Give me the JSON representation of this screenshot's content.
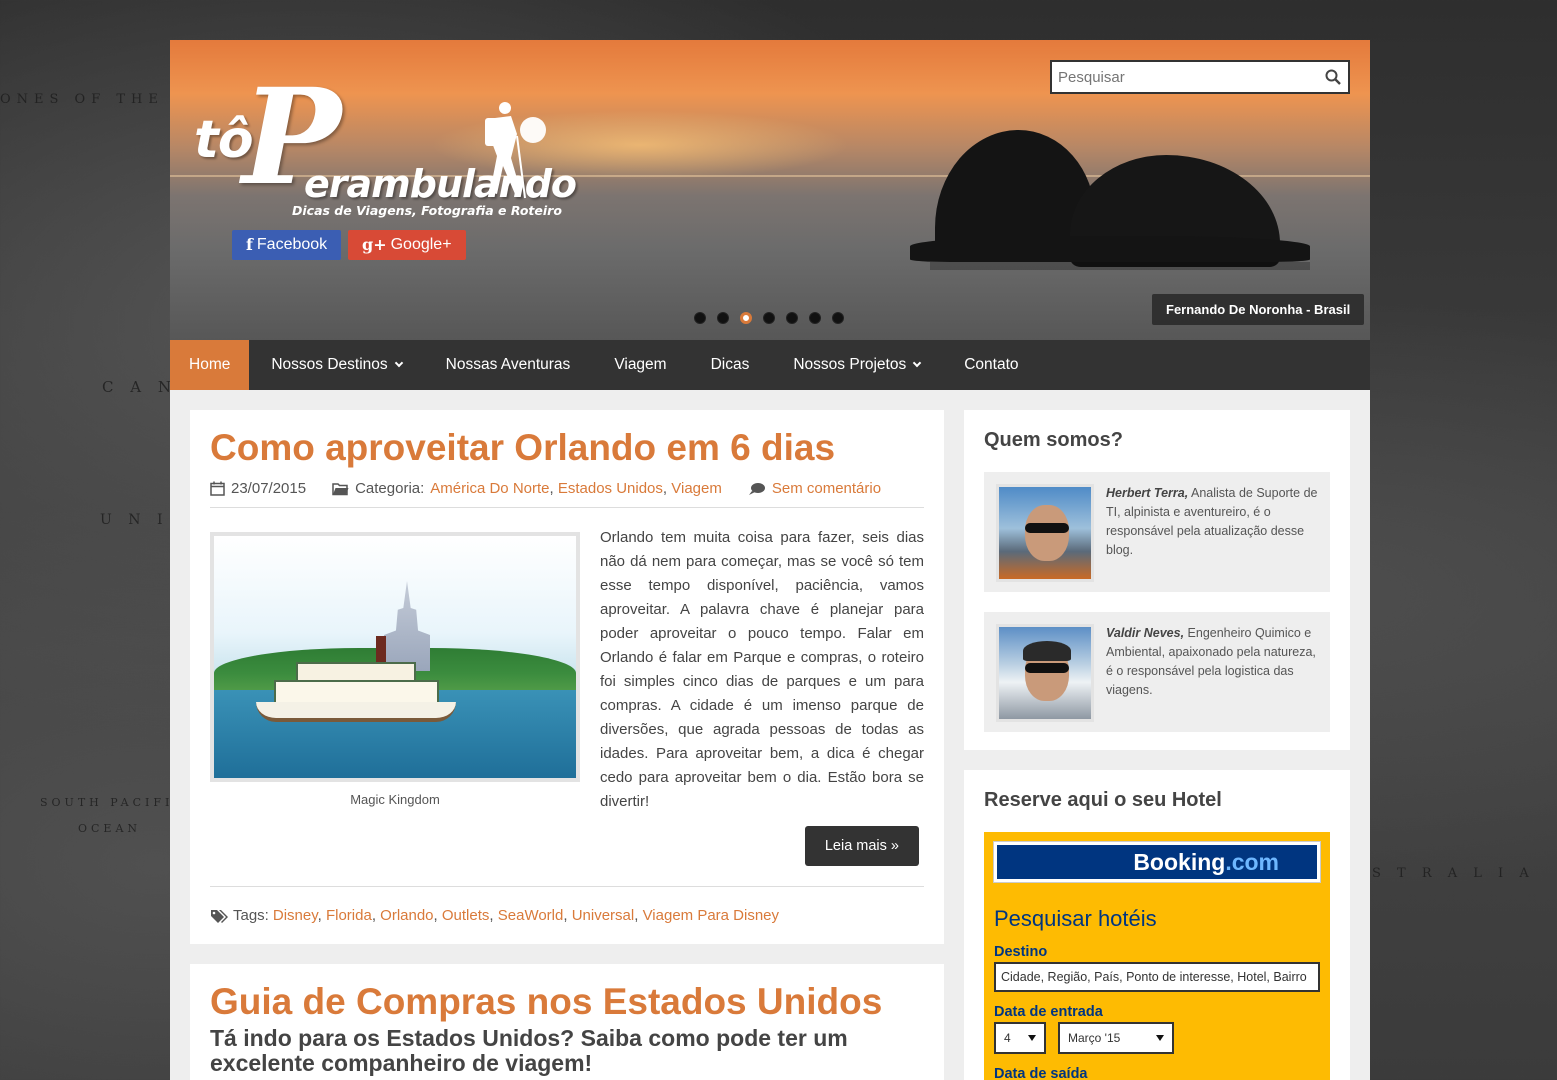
{
  "map_labels": [
    "ONES OF THE WOR",
    "C A N",
    "U N I T E",
    "SOUTH  PACIFIC",
    "OCEAN",
    "S T R A L I A"
  ],
  "header": {
    "logo": {
      "prefix": "tô",
      "initial": "P",
      "rest": "erambulando",
      "tagline": "Dicas de Viagens, Fotografia e Roteiro"
    },
    "social": [
      {
        "icon": "facebook-icon",
        "label": "Facebook",
        "color": "#3b5eb3"
      },
      {
        "icon": "google-plus-icon",
        "label": "Google+",
        "color": "#d84a36"
      }
    ],
    "search": {
      "placeholder": "Pesquisar",
      "icon": "search-icon"
    },
    "slider": {
      "count": 7,
      "active_index": 2,
      "caption": "Fernando De Noronha - Brasil"
    }
  },
  "nav": {
    "items": [
      {
        "label": "Home",
        "active": true,
        "dropdown": false
      },
      {
        "label": "Nossos Destinos",
        "dropdown": true
      },
      {
        "label": "Nossas Aventuras",
        "dropdown": false
      },
      {
        "label": "Viagem",
        "dropdown": false
      },
      {
        "label": "Dicas",
        "dropdown": false
      },
      {
        "label": "Nossos Projetos",
        "dropdown": true
      },
      {
        "label": "Contato",
        "dropdown": false
      }
    ]
  },
  "posts": [
    {
      "title": "Como aproveitar Orlando em 6 dias",
      "date": "23/07/2015",
      "category_label": "Categoria:",
      "categories": [
        "América Do Norte",
        "Estados Unidos",
        "Viagem"
      ],
      "comments": "Sem comentário",
      "image_caption": "Magic Kingdom",
      "excerpt": "Orlando tem muita coisa para fazer, seis dias não dá nem para começar, mas se você só tem esse tempo disponível, paciência, vamos aproveitar. A palavra chave é planejar para poder aproveitar o pouco tempo. Falar em Orlando é falar em Parque e compras, o roteiro foi simples cinco dias de parques e um para compras. A cidade é um imenso parque de diversões, que agrada pessoas de todas as idades. Para aproveitar bem, a dica é chegar cedo para aproveitar bem o dia. Estão bora se divertir!",
      "read_more": "Leia mais »",
      "tags_label": "Tags:",
      "tags": [
        "Disney",
        "Florida",
        "Orlando",
        "Outlets",
        "SeaWorld",
        "Universal",
        "Viagem Para Disney"
      ]
    },
    {
      "title": "Guia de Compras nos Estados Unidos",
      "subtitle": "Tá indo para os Estados Unidos? Saiba como pode ter um excelente companheiro de viagem!"
    }
  ],
  "sidebar": {
    "about": {
      "title": "Quem somos?",
      "people": [
        {
          "name": "Herbert Terra,",
          "bio": " Analista de Suporte de TI, alpinista e aventureiro, é o responsável pela atualização desse blog."
        },
        {
          "name": "Valdir Neves,",
          "bio": " Engenheiro Quimico e Ambiental, apaixonado pela natureza, é o responsável pela logistica das viagens."
        }
      ]
    },
    "hotel": {
      "title": "Reserve aqui o seu Hotel",
      "logo_main": "Booking",
      "logo_suffix": ".com",
      "heading": "Pesquisar hotéis",
      "destination_label": "Destino",
      "destination_placeholder": "Cidade, Região, País, Ponto de interesse, Hotel, Bairro",
      "checkin_label": "Data de entrada",
      "checkin_day": "4",
      "checkin_month": "Março '15",
      "checkout_label": "Data de saída"
    }
  },
  "colors": {
    "accent": "#d97a3a",
    "nav_bg": "#333333",
    "booking_yellow": "#febb02",
    "booking_blue": "#003580"
  }
}
